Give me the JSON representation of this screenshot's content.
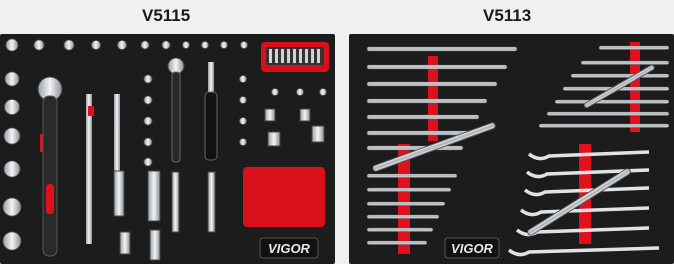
{
  "titles": {
    "left": "V5115",
    "right": "V5113"
  },
  "logos": {
    "left": "VIGOR",
    "right": "VIGOR"
  },
  "colors": {
    "foam": "#1c1c1c",
    "accent": "#e0101c",
    "chrome": "#d9dde2",
    "background": "#eef0f2"
  }
}
